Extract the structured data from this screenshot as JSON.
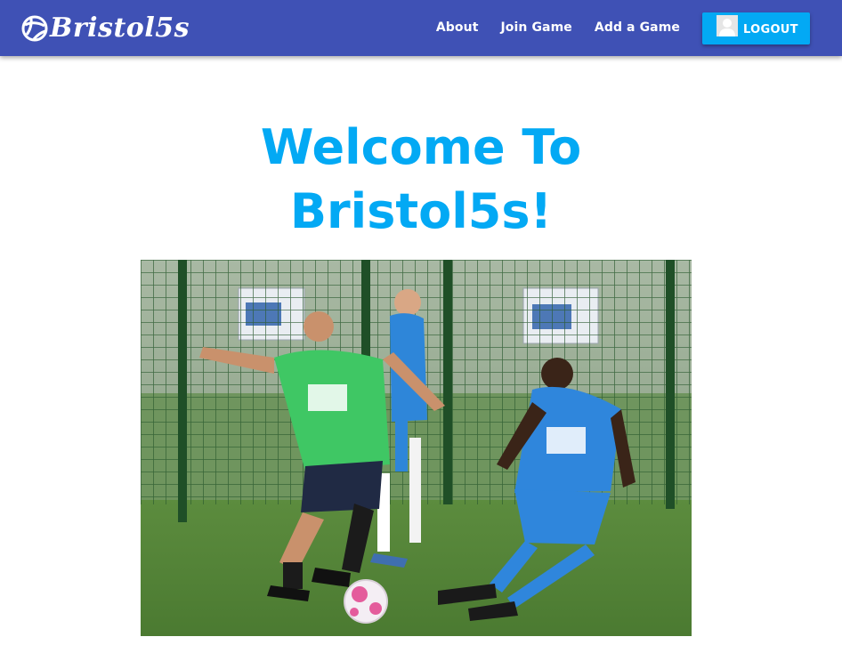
{
  "navbar": {
    "brand": "Bristol5s",
    "links": [
      "About",
      "Join Game",
      "Add a Game"
    ],
    "logout_label": "LOGOUT"
  },
  "hero": {
    "title_line1": "Welcome To",
    "title_line2": "Bristol5s!",
    "image_alt": "Two players contesting a football on an artificial five-a-side pitch"
  },
  "colors": {
    "navbar": "#3f51b5",
    "accent": "#03a9f4",
    "title": "#03a9f4",
    "green_kit": "#3ecb6c",
    "blue_kit": "#1f7fd6"
  },
  "icons": {
    "brand": "football-icon",
    "avatar": "user-avatar-icon"
  }
}
